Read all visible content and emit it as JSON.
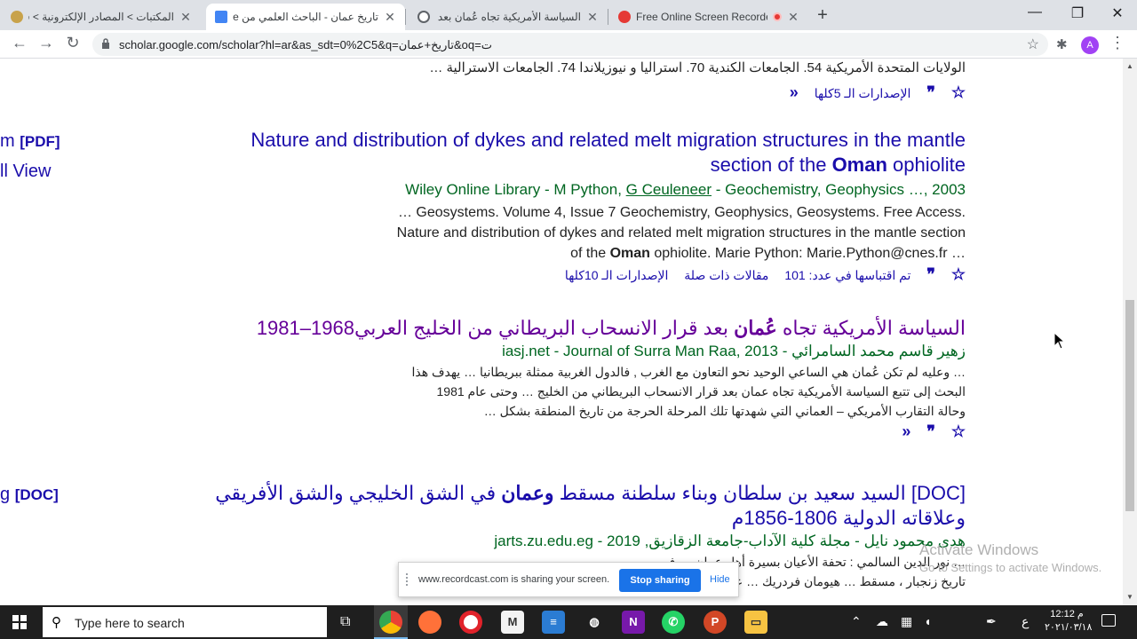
{
  "tabs": [
    {
      "title": "المكتبات > المصادر الإلكترونية > قـ",
      "favicon_color": "#c8a24a",
      "active": false
    },
    {
      "title": "تاريخ عمان - الباحث العلمي من Google",
      "favicon_color": "#4285f4",
      "active": true
    },
    {
      "title": "السياسة الأمريكية تجاه عُمان بعد قرار",
      "favicon_color": "#5f6368",
      "active": false
    },
    {
      "title": "Free Online Screen Recorder",
      "favicon_color": "#e53935",
      "active": false
    }
  ],
  "new_tab": "+",
  "window_controls": {
    "minimize": "—",
    "maximize": "❐",
    "close": "✕"
  },
  "toolbar": {
    "back": "←",
    "forward": "→",
    "reload": "↻",
    "url": "scholar.google.com/scholar?hl=ar&as_sdt=0%2C5&q=تاريخ+عمان&oq=ت",
    "avatar_letter": "A"
  },
  "side_links": [
    {
      "text": "m",
      "tag": "[PDF]"
    },
    {
      "text": "ll View",
      "tag": ""
    },
    {
      "text": "g",
      "tag": "[DOC]"
    }
  ],
  "results": [
    {
      "snippet": "الولايات المتحدة الأمريكية 54. الجامعات الكندية 70. استراليا و نيوزيلاندا 74. الجامعات الاسترالية …",
      "versions": "الإصدارات الـ 5كلها"
    },
    {
      "title_pre": "Nature and distribution of dykes and related melt migration structures in the mantle section of the ",
      "title_bold": "Oman",
      "title_post": " ophiolite",
      "meta_pre": "Wiley Online Library - M Python, ",
      "meta_author": "G Ceuleneer",
      "meta_post": " - Geochemistry, Geophysics …, 2003",
      "snippet_1": "… Geosystems. Volume 4, Issue 7 Geochemistry, Geophysics, Geosystems. Free Access.",
      "snippet_2": "Nature and distribution of dykes and related melt migration structures in the mantle section",
      "snippet_3_pre": "of the ",
      "snippet_3_bold": "Oman",
      "snippet_3_post": " ophiolite. Marie Python: Marie.Python@cnes.fr …",
      "cited_by": "تم اقتباسها في عدد: 101",
      "related": "مقالات ذات صلة",
      "versions": "الإصدارات الـ 10كلها"
    },
    {
      "title_pre": "السياسة الأمريكية تجاه ",
      "title_bold": "عُمان",
      "title_post": " بعد قرار الانسحاب البريطاني من الخليج العربي1968–1981",
      "meta_pre": "زهير قاسم محمد السامرائي",
      "meta_post": " - iasj.net - Journal of Surra Man Raa, 2013",
      "snippet_1": "… وعليه لم تكن عُمان هي الساعي الوحيد نحو التعاون مع الغرب , فالدول الغربية ممثلة ببريطانيا … يهدف هذا",
      "snippet_2": "البحث إلى تتبع السياسة الأمريكية تجاه عمان بعد قرار الانسحاب البريطاني من الخليج … وحتى عام 1981",
      "snippet_3": "وحالة التقارب الأمريكي – العماني التي شهدتها تلك المرحلة الحرجة من تاريخ المنطقة بشكل …"
    },
    {
      "title_tag": "[DOC]",
      "title_pre": " السيد سعيد بن سلطان وبناء سلطنة مسقط ",
      "title_bold": "وعمان",
      "title_post": " في الشق الخليجي والشق الأفريقي وعلاقاته الدولية 1806-1856م",
      "meta_pre": "هدى محمود نايل - مجلة كلية الآداب-جامعة الزقازيق",
      "meta_post": ", 2019 - jarts.zu.edu.eg",
      "snippet_1": "… نور الدين السالمي : تحفة الأعيان بسيرة أهل عمان … في",
      "snippet_2": "تاريخ زنجبار ، مسقط … هيومان فردريك … عمان"
    }
  ],
  "icons": {
    "star": "☆",
    "cite": "❞",
    "more": "«"
  },
  "share_bar": {
    "message": "www.recordcast.com is sharing your screen.",
    "stop_label": "Stop sharing",
    "hide_label": "Hide"
  },
  "watermark": {
    "line1": "Activate Windows",
    "line2": "Go to Settings to activate Windows."
  },
  "taskbar": {
    "search_placeholder": "Type here to search",
    "clock_time": "12:12 م",
    "clock_date": "٢٠٢١/٠٣/١٨",
    "lang": "ع"
  }
}
